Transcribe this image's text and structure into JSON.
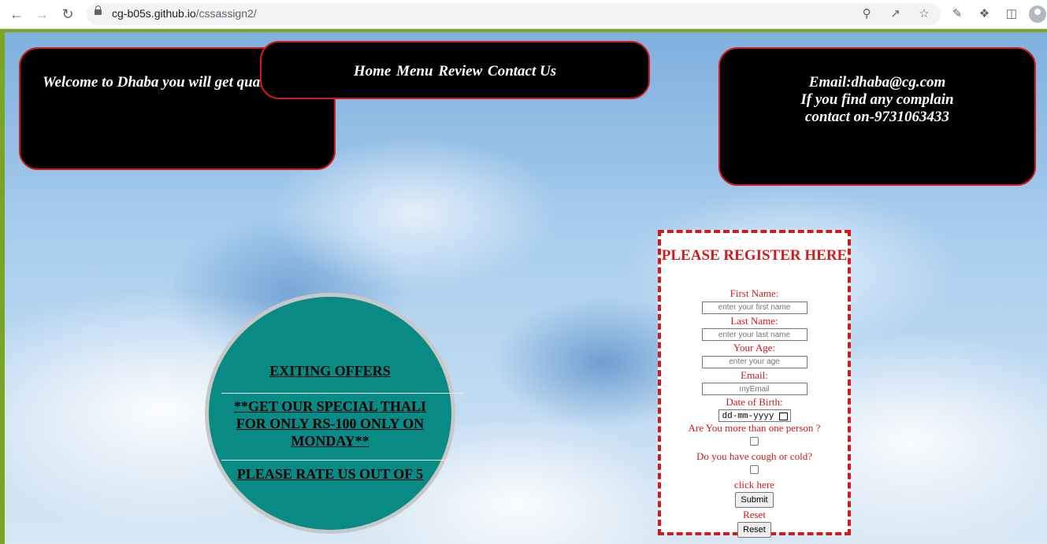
{
  "browser": {
    "url_host": "cg-b05s.github.io",
    "url_path": "/cssassign2/"
  },
  "welcome": {
    "text": "Welcome to Dhaba you will get quality food"
  },
  "navbar": {
    "items": [
      "Home",
      "Menu",
      "Review",
      "Contact Us"
    ]
  },
  "contact": {
    "email": "Email:dhaba@cg.com",
    "line2": "If you find any complain",
    "line3": "contact on-9731063433"
  },
  "offers": {
    "title": "EXITING OFFERS",
    "deal": "**GET OUR SPECIAL THALI FOR ONLY RS-100 ONLY ON MONDAY**",
    "rate": "PLEASE RATE US OUT OF 5"
  },
  "register": {
    "title": "PLEASE REGISTER HERE",
    "first_name_label": "First Name:",
    "first_name_placeholder": "enter your first name",
    "last_name_label": "Last Name:",
    "last_name_placeholder": "enter your last name",
    "age_label": "Your Age:",
    "age_placeholder": "enter your age",
    "email_label": "Email:",
    "email_placeholder": "myEmail",
    "dob_label": "Date of Birth:",
    "dob_placeholder": "dd-mm-yyyy",
    "more_than_one_label": "Are You more than one person ?",
    "cough_label": "Do you have cough or cold?",
    "click_here_label": "click here",
    "submit_label": "Submit",
    "reset_label": "Reset",
    "reset_button": "Reset"
  },
  "colors": {
    "accent_red": "#d11a1a",
    "teal": "#0a8a84",
    "green_frame": "#7aa524"
  }
}
